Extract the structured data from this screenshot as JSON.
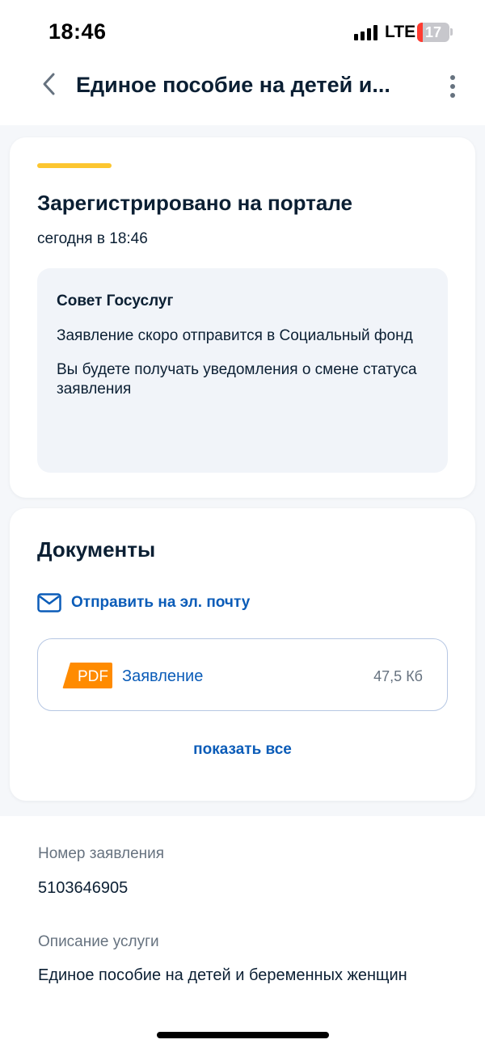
{
  "status_bar": {
    "time": "18:46",
    "network": "LTE",
    "battery": "17"
  },
  "header": {
    "title": "Единое пособие на детей и..."
  },
  "status_card": {
    "title": "Зарегистрировано на портале",
    "time": "сегодня в 18:46",
    "tip": {
      "title": "Совет Госуслуг",
      "paragraphs": [
        "Заявление скоро отправится в Социальный фонд",
        "Вы будете получать уведомления о смене статуса заявления"
      ]
    }
  },
  "documents": {
    "title": "Документы",
    "send_email_label": "Отправить на эл. почту",
    "items": [
      {
        "badge": "PDF",
        "name": "Заявление",
        "size": "47,5 Кб"
      }
    ],
    "show_all_label": "показать все"
  },
  "application_info": {
    "number_label": "Номер заявления",
    "number_value": "5103646905",
    "service_label": "Описание услуги",
    "service_value": "Единое пособие на детей и беременных женщин"
  },
  "colors": {
    "accent_yellow": "#fcc630",
    "link_blue": "#0b5cb8",
    "pdf_orange": "#ff8b00",
    "tip_bg": "#f1f4f9"
  }
}
